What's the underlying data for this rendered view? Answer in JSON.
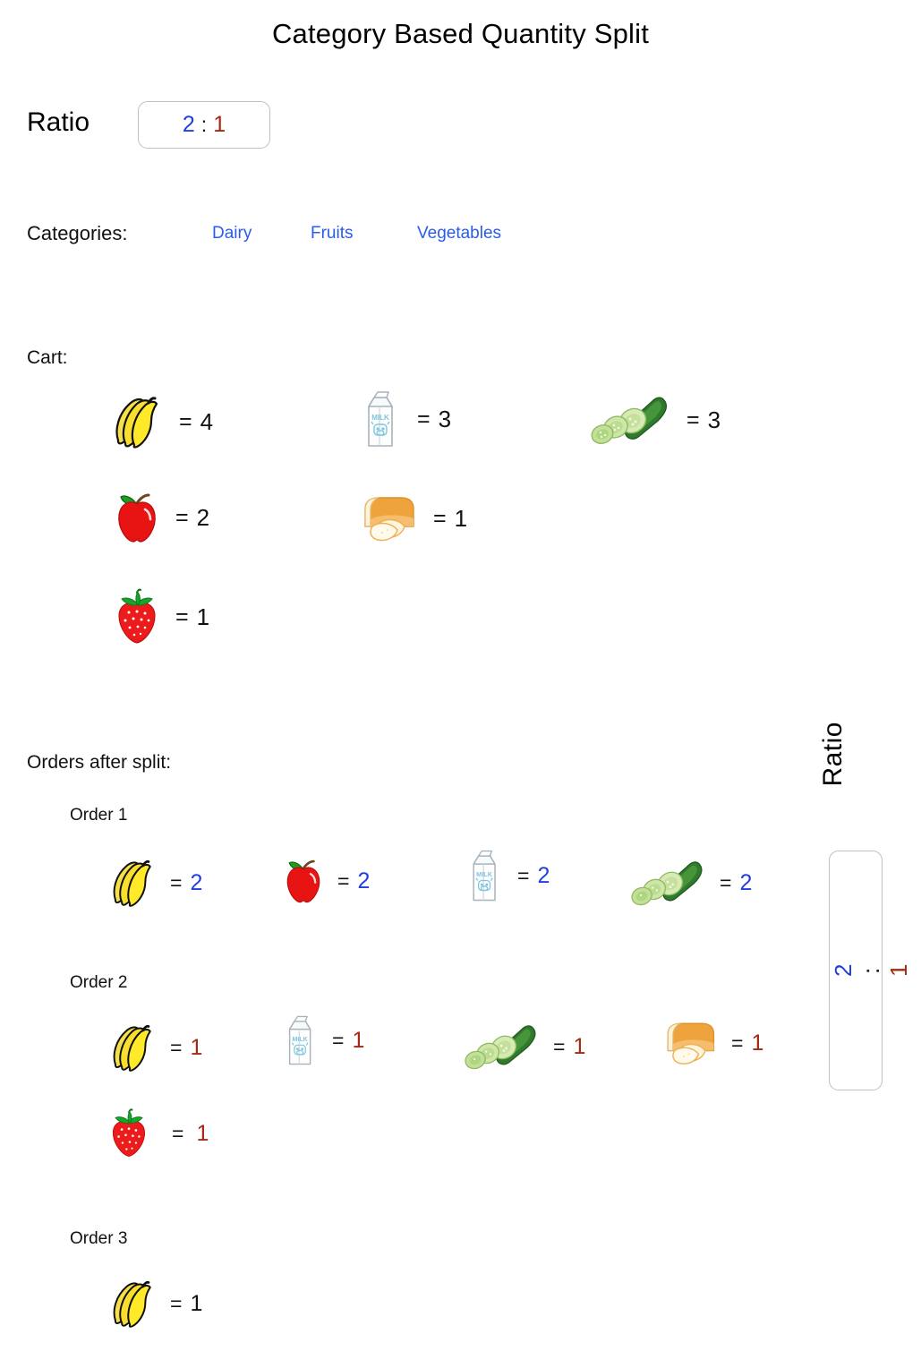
{
  "page": {
    "title": "Category Based Quantity Split",
    "background": "#ffffff"
  },
  "colors": {
    "order1_accent": "#1f3fe0",
    "order2_accent": "#a32a14",
    "category_link": "#2b5ce6",
    "text": "#111111",
    "box_border": "#c0c0c0"
  },
  "ratio": {
    "label": "Ratio",
    "first": "2",
    "separator": ":",
    "second": "1"
  },
  "categories": {
    "label": "Categories:",
    "items": [
      {
        "label": "Dairy"
      },
      {
        "label": "Fruits"
      },
      {
        "label": "Vegetables"
      }
    ]
  },
  "cart": {
    "label": "Cart:",
    "items": [
      {
        "icon": "banana-icon",
        "name": "banana",
        "eq": "=",
        "qty": "4"
      },
      {
        "icon": "milk-icon",
        "name": "milk",
        "eq": "=",
        "qty": "3"
      },
      {
        "icon": "cucumber-icon",
        "name": "cucumber",
        "eq": "=",
        "qty": "3"
      },
      {
        "icon": "apple-icon",
        "name": "apple",
        "eq": "=",
        "qty": "2"
      },
      {
        "icon": "bread-icon",
        "name": "bread",
        "eq": "=",
        "qty": "1"
      },
      {
        "icon": "strawberry-icon",
        "name": "strawberry",
        "eq": "=",
        "qty": "1"
      }
    ]
  },
  "orders_section": {
    "label": "Orders after split:",
    "orders": [
      {
        "label": "Order 1",
        "accent": "#1f3fe0",
        "items": [
          {
            "icon": "banana-icon",
            "name": "banana",
            "eq": "=",
            "qty": "2"
          },
          {
            "icon": "apple-icon",
            "name": "apple",
            "eq": "=",
            "qty": "2"
          },
          {
            "icon": "milk-icon",
            "name": "milk",
            "eq": "=",
            "qty": "2"
          },
          {
            "icon": "cucumber-icon",
            "name": "cucumber",
            "eq": "=",
            "qty": "2"
          }
        ]
      },
      {
        "label": "Order 2",
        "accent": "#a32a14",
        "items": [
          {
            "icon": "banana-icon",
            "name": "banana",
            "eq": "=",
            "qty": "1"
          },
          {
            "icon": "milk-icon",
            "name": "milk",
            "eq": "=",
            "qty": "1"
          },
          {
            "icon": "cucumber-icon",
            "name": "cucumber",
            "eq": "=",
            "qty": "1"
          },
          {
            "icon": "bread-icon",
            "name": "bread",
            "eq": "=",
            "qty": "1"
          },
          {
            "icon": "strawberry-icon",
            "name": "strawberry",
            "eq": "=",
            "qty": "1"
          }
        ]
      },
      {
        "label": "Order 3",
        "accent": "#111111",
        "items": [
          {
            "icon": "banana-icon",
            "name": "banana",
            "eq": "=",
            "qty": "1"
          }
        ]
      }
    ]
  },
  "vertical_ratio": {
    "label": "Ratio",
    "first": "2",
    "separator": ":",
    "second": "1"
  }
}
